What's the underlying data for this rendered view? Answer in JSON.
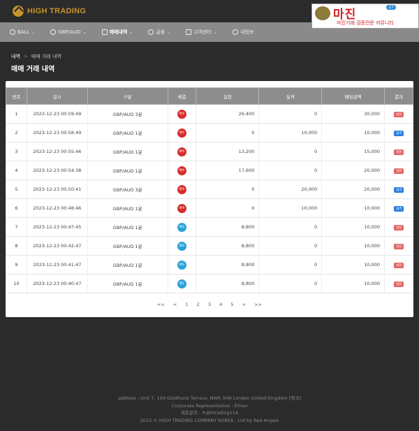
{
  "header": {
    "logo_text": "HIGH TRADING"
  },
  "banner": {
    "main": "마진",
    "badge": "27",
    "sub": "마진거래 검증전문 커뮤니티"
  },
  "nav": {
    "items": [
      {
        "label": "BALL"
      },
      {
        "label": "GBP/AUD"
      },
      {
        "label": "매매내역"
      },
      {
        "label": "금융"
      },
      {
        "label": "고객센터"
      },
      {
        "label": "내정보"
      }
    ]
  },
  "breadcrumb": {
    "home": "내역",
    "sep": ">",
    "current": "매매 거래 내역"
  },
  "page_title": "매매 거래 내역",
  "table": {
    "headers": [
      "번호",
      "일시",
      "구분",
      "체결",
      "실현",
      "실격",
      "배팅금액",
      "결과"
    ],
    "rows": [
      {
        "no": "1",
        "dt": "2023-12-23 00:59:49",
        "type": "GBP/AUD 3분",
        "side": "매수",
        "realized": "26,400",
        "lost": "0",
        "bet": "30,000",
        "result": "실현"
      },
      {
        "no": "2",
        "dt": "2023-12-23 00:58:49",
        "type": "GBP/AUD 1분",
        "side": "매수",
        "realized": "0",
        "lost": "10,000",
        "bet": "10,000",
        "result": "실격"
      },
      {
        "no": "3",
        "dt": "2023-12-23 00:55:46",
        "type": "GBP/AUD 1분",
        "side": "매수",
        "realized": "13,200",
        "lost": "0",
        "bet": "15,000",
        "result": "실현"
      },
      {
        "no": "4",
        "dt": "2023-12-23 00:54:38",
        "type": "GBP/AUD 1분",
        "side": "매수",
        "realized": "17,600",
        "lost": "0",
        "bet": "20,000",
        "result": "실현"
      },
      {
        "no": "5",
        "dt": "2023-12-23 00:50:41",
        "type": "GBP/AUD 3분",
        "side": "매수",
        "realized": "0",
        "lost": "20,000",
        "bet": "20,000",
        "result": "실격"
      },
      {
        "no": "6",
        "dt": "2023-12-23 00:48:46",
        "type": "GBP/AUD 1분",
        "side": "매수",
        "realized": "0",
        "lost": "10,000",
        "bet": "10,000",
        "result": "실격"
      },
      {
        "no": "7",
        "dt": "2023-12-23 00:47:45",
        "type": "GBP/AUD 1분",
        "side": "매도",
        "realized": "8,800",
        "lost": "0",
        "bet": "10,000",
        "result": "실현"
      },
      {
        "no": "8",
        "dt": "2023-12-23 00:42:47",
        "type": "GBP/AUD 1분",
        "side": "매도",
        "realized": "8,800",
        "lost": "0",
        "bet": "10,000",
        "result": "실현"
      },
      {
        "no": "9",
        "dt": "2023-12-23 00:41:47",
        "type": "GBP/AUD 1분",
        "side": "매도",
        "realized": "8,800",
        "lost": "0",
        "bet": "10,000",
        "result": "실현"
      },
      {
        "no": "10",
        "dt": "2023-12-23 00:40:47",
        "type": "GBP/AUD 1분",
        "side": "매도",
        "realized": "8,800",
        "lost": "0",
        "bet": "10,000",
        "result": "실현"
      }
    ]
  },
  "pagination": {
    "first": "<<",
    "prev": "<",
    "pages": [
      "1",
      "2",
      "3",
      "4",
      "5"
    ],
    "next": ">",
    "last": ">>"
  },
  "footer": {
    "address": "address : Unit 7, 109 Goldhurst Terrace, NW6 3HA London United Kingdom [영국]",
    "rep": "Corporate Representative : Ethan",
    "contact": "제휴문의 : ✈@htrading114",
    "copyright": "2022 © HIGH TRADING COMPANY KOREA , Ltd by Red Angels"
  }
}
